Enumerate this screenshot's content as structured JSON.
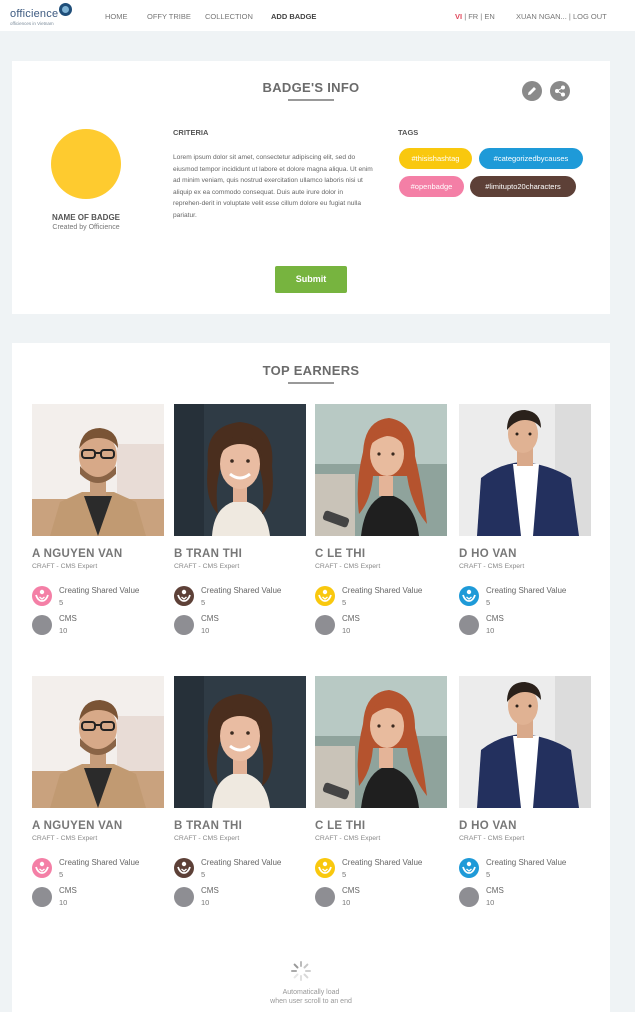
{
  "nav": {
    "logo_word": "officience",
    "logo_tagline": "officiences in Vietnam",
    "links": [
      "HOME",
      "OFFY TRIBE",
      "COLLECTION",
      "ADD BADGE"
    ],
    "lang_active": "VI",
    "lang_rest": "| FR | EN",
    "user": "XUAN NGAN... | LOG OUT"
  },
  "badge_info": {
    "title": "BADGE'S INFO",
    "badge_color": "#fecb2f",
    "badge_name": "NAME OF BADGE",
    "created_by": "Created by Officience",
    "criteria_label": "CRITERIA",
    "criteria_text": "Lorem ipsum dolor sit amet, consectetur adipiscing elit, sed do eiusmod tempor incididunt ut labore et dolore magna aliqua. Ut enim ad minim veniam, quis nostrud exercitation ullamco laboris nisi ut aliquip ex ea commodo consequat. Duis aute irure dolor in reprehen-derit in voluptate velit esse cillum dolore eu fugiat nulla pariatur.",
    "tags_label": "TAGS",
    "tags": [
      {
        "text": "#thisishashtag",
        "color": "#f9c80e"
      },
      {
        "text": "#categorizedbycauses",
        "color": "#1e9ad8"
      },
      {
        "text": "#openbadge",
        "color": "#f47fa6"
      },
      {
        "text": "#limitupto20characters",
        "color": "#5d4037"
      }
    ],
    "submit_label": "Submit",
    "edit_icon": "pencil-icon",
    "share_icon": "share-icon"
  },
  "top_earners": {
    "title": "TOP EARNERS",
    "rows": [
      [
        {
          "name": "A NGUYEN VAN",
          "role": "CRAFT - CMS Expert",
          "achievements": [
            {
              "title": "Creating Shared Value",
              "count": "5",
              "color": "#f47fa6"
            },
            {
              "title": "CMS",
              "count": "10",
              "color": "#8e8e93"
            }
          ]
        },
        {
          "name": "B TRAN THI",
          "role": "CRAFT - CMS Expert",
          "achievements": [
            {
              "title": "Creating Shared Value",
              "count": "5",
              "color": "#5d4037"
            },
            {
              "title": "CMS",
              "count": "10",
              "color": "#8e8e93"
            }
          ]
        },
        {
          "name": "C LE THI",
          "role": "CRAFT - CMS Expert",
          "achievements": [
            {
              "title": "Creating Shared Value",
              "count": "5",
              "color": "#f9c80e"
            },
            {
              "title": "CMS",
              "count": "10",
              "color": "#8e8e93"
            }
          ]
        },
        {
          "name": "D HO VAN",
          "role": "CRAFT - CMS Expert",
          "achievements": [
            {
              "title": "Creating Shared Value",
              "count": "5",
              "color": "#1e9ad8"
            },
            {
              "title": "CMS",
              "count": "10",
              "color": "#8e8e93"
            }
          ]
        }
      ],
      [
        {
          "name": "A NGUYEN VAN",
          "role": "CRAFT - CMS Expert",
          "achievements": [
            {
              "title": "Creating Shared Value",
              "count": "5",
              "color": "#f47fa6"
            },
            {
              "title": "CMS",
              "count": "10",
              "color": "#8e8e93"
            }
          ]
        },
        {
          "name": "B TRAN THI",
          "role": "CRAFT - CMS Expert",
          "achievements": [
            {
              "title": "Creating Shared Value",
              "count": "5",
              "color": "#5d4037"
            },
            {
              "title": "CMS",
              "count": "10",
              "color": "#8e8e93"
            }
          ]
        },
        {
          "name": "C LE THI",
          "role": "CRAFT - CMS Expert",
          "achievements": [
            {
              "title": "Creating Shared Value",
              "count": "5",
              "color": "#f9c80e"
            },
            {
              "title": "CMS",
              "count": "10",
              "color": "#8e8e93"
            }
          ]
        },
        {
          "name": "D HO VAN",
          "role": "CRAFT - CMS Expert",
          "achievements": [
            {
              "title": "Creating Shared Value",
              "count": "5",
              "color": "#1e9ad8"
            },
            {
              "title": "CMS",
              "count": "10",
              "color": "#8e8e93"
            }
          ]
        }
      ]
    ],
    "auto_load_line1": "Automatically load",
    "auto_load_line2": "when user scroll to an end"
  }
}
